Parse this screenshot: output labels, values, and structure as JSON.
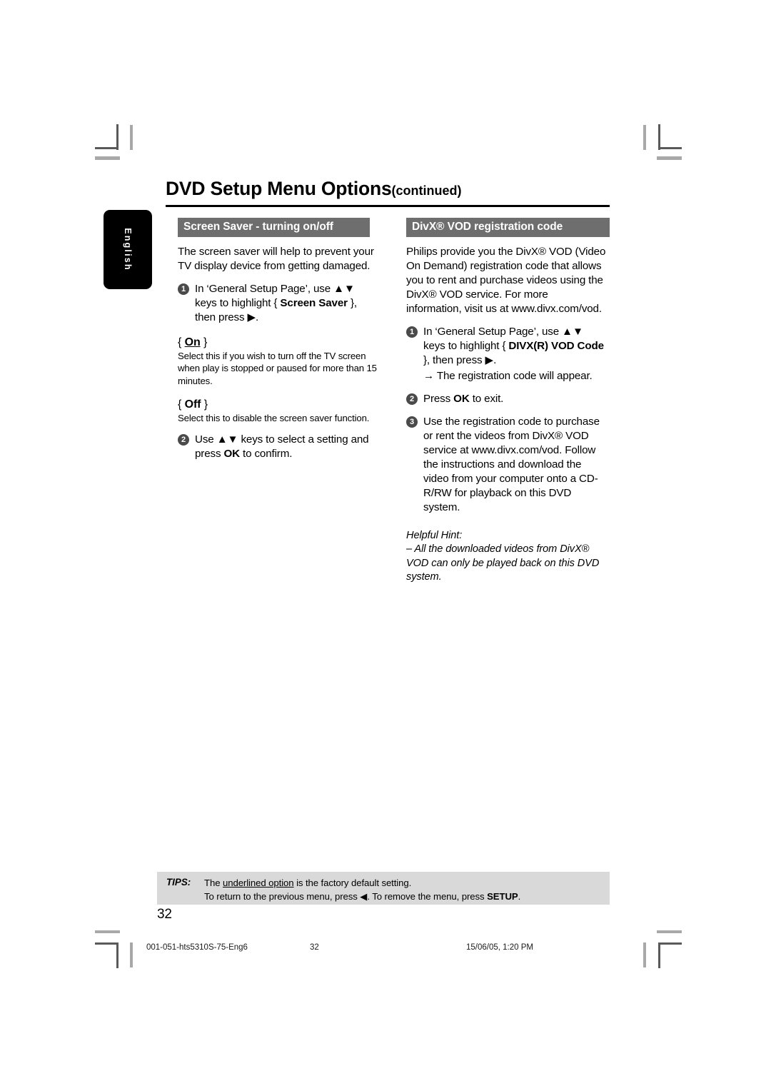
{
  "document": {
    "title_main": "DVD Setup Menu Options",
    "title_continued": "(continued)",
    "language_tab": "English",
    "page_number": "32"
  },
  "left_column": {
    "section_heading": "Screen Saver - turning on/off",
    "intro": "The screen saver will help to prevent your TV display device from getting damaged.",
    "step1": {
      "number": "1",
      "text_before": "In ‘General Setup Page’, use ▲▼ keys to highlight { ",
      "bold": "Screen Saver",
      "text_after": " }, then press ▶."
    },
    "option_on": {
      "open_brace": "{ ",
      "label": "On",
      "close_brace": " }",
      "description": "Select this if you wish to turn off the TV screen when play is stopped or paused for more than 15 minutes."
    },
    "option_off": {
      "open_brace": "{ ",
      "label": "Off",
      "close_brace": " }",
      "description": "Select this to disable the screen saver function."
    },
    "step2": {
      "number": "2",
      "text_before": "Use ▲▼ keys to select a setting and press ",
      "bold": "OK",
      "text_after": " to confirm."
    }
  },
  "right_column": {
    "section_heading": "DivX® VOD registration code",
    "intro": "Philips provide you the DivX® VOD (Video On Demand) registration code that allows you to rent and purchase videos using the DivX® VOD service. For more information, visit us at www.divx.com/vod.",
    "step1": {
      "number": "1",
      "text_before": "In ‘General Setup Page’, use ▲▼ keys to highlight { ",
      "bold": "DIVX(R) VOD Code",
      "text_after": " }, then press ▶.",
      "sub_note": "→ The registration code will appear."
    },
    "step2": {
      "number": "2",
      "text_before": "Press ",
      "bold": "OK",
      "text_after": " to exit."
    },
    "step3": {
      "number": "3",
      "text": "Use the registration code to purchase or rent the videos from DivX® VOD service at www.divx.com/vod.  Follow the instructions and download the video from your computer onto a CD-R/RW for playback on this DVD system."
    },
    "hint": {
      "title": "Helpful Hint:",
      "body": "– All the downloaded videos from DivX® VOD can only be played back on this DVD system."
    }
  },
  "tips": {
    "label": "TIPS:",
    "line1_before": "The ",
    "line1_underlined": "underlined option",
    "line1_after": " is the factory default setting.",
    "line2_before": "To return to the previous menu, press ◀. To remove the menu, press ",
    "line2_bold": "SETUP",
    "line2_after": "."
  },
  "print_footer": {
    "file": "001-051-hts5310S-75-Eng6",
    "page": "32",
    "date": "15/06/05, 1:20 PM"
  },
  "colors": {
    "section_bar": "#6e6e6e",
    "tips_background": "#d9d9d9",
    "step_marker": "#4a4a4a",
    "language_tab": "#000000"
  }
}
